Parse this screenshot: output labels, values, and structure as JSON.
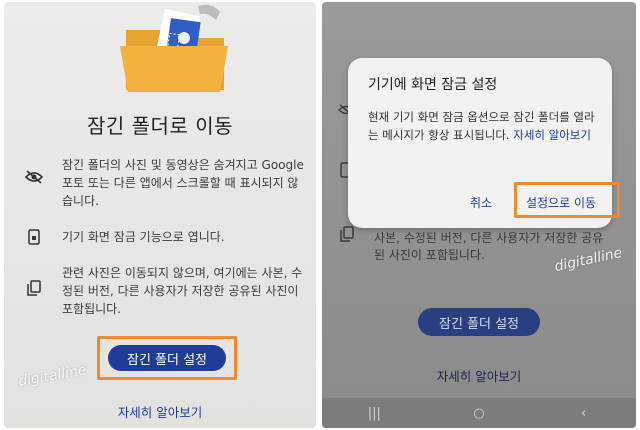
{
  "left_screen": {
    "title": "잠긴 폴더로 이동",
    "info_rows": [
      {
        "icon": "eye-off-icon",
        "text": "잠긴 폴더의 사진 및 동영상은 숨겨지고 Google 포토 또는 다른 앱에서 스크롤할 때 표시되지 않습니다."
      },
      {
        "icon": "phone-lock-icon",
        "text": "기기 화면 잠금 기능으로 엽니다."
      },
      {
        "icon": "copy-icon",
        "text": "관련 사진은 이동되지 않으며, 여기에는 사본, 수정된 버전, 다른 사용자가 저장한 공유된 사진이 포함됩니다."
      }
    ],
    "setup_button": "잠긴 폴더 설정",
    "learn_more": "자세히 알아보기",
    "watermark": "digitalline"
  },
  "right_screen": {
    "dialog": {
      "title": "기기에 화면 잠금 설정",
      "body": "현재 기기 화면 잠금 옵션으로 잠긴 폴더를 열라는 메시지가 항상 표시됩니다.",
      "link": "자세히 알아보기",
      "cancel": "취소",
      "go_to_settings": "설정으로 이동"
    },
    "background_text": "사본, 수정된 버전, 다른 사용자가 저장한 공유된 사진이 포함됩니다.",
    "setup_button": "잠긴 폴더 설정",
    "learn_more": "자세히 알아보기",
    "watermark": "digitalline",
    "navbar": {
      "recents": "|||",
      "home": "○",
      "back": "‹"
    }
  },
  "colors": {
    "accent_blue": "#1f3c98",
    "highlight_orange": "#f08a32",
    "folder_yellow": "#f5b13d"
  }
}
